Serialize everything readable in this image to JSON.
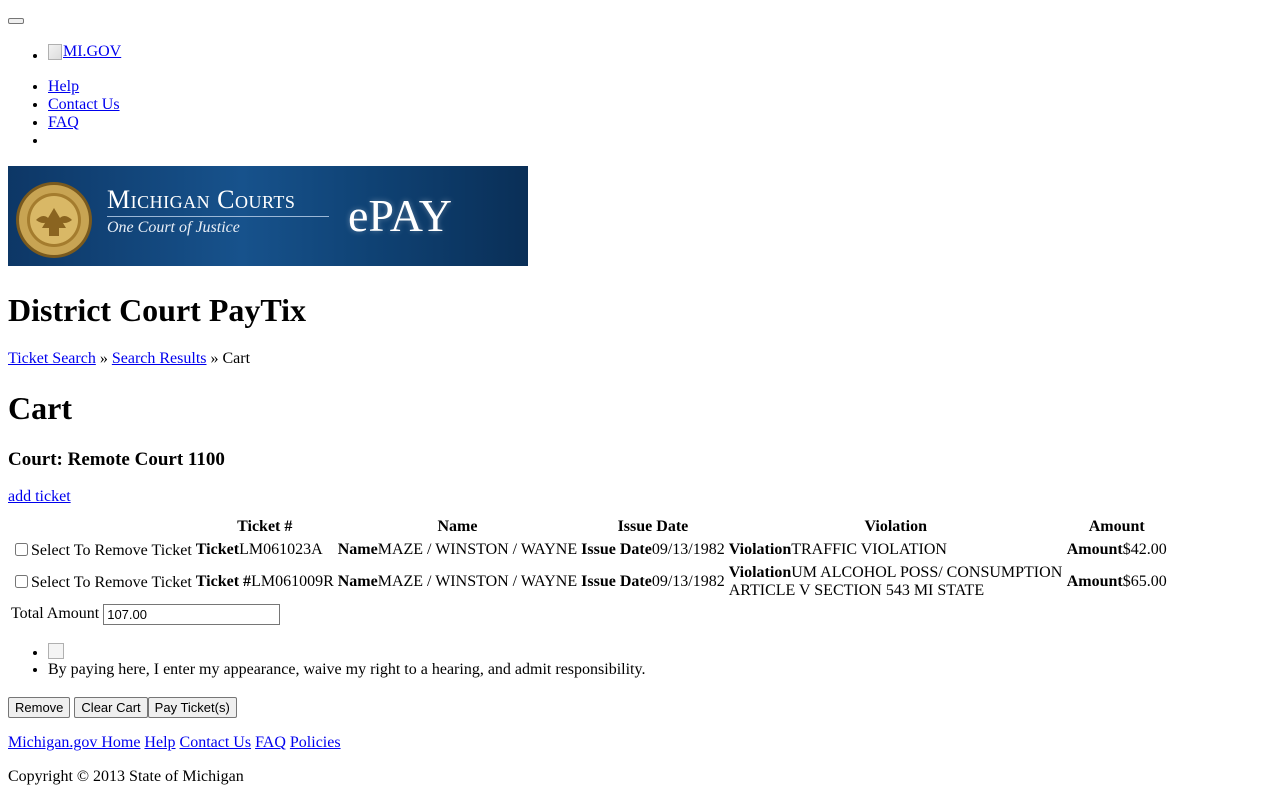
{
  "header": {
    "menu_button_label": "",
    "logo_alt": "MI.GOV",
    "nav_links": [
      "Help",
      "Contact Us",
      "FAQ"
    ]
  },
  "banner": {
    "title": "Michigan Courts",
    "subtitle": "One Court of Justice",
    "product": "ePAY",
    "colors": {
      "background": "#17528c",
      "text": "#ffffff"
    }
  },
  "page_title": "District Court PayTix",
  "breadcrumb": {
    "items": [
      "Ticket Search",
      "Search Results",
      "Cart"
    ],
    "separator": "»"
  },
  "cart": {
    "heading": "Cart",
    "court_heading": "Court: Remote Court 1100",
    "add_ticket_label": "add ticket",
    "columns": [
      "Ticket #",
      "Name",
      "Issue Date",
      "Violation",
      "Amount"
    ],
    "rows": [
      {
        "select_label": "Select To Remove Ticket",
        "ticket_label": "Ticket",
        "ticket": "LM061023A",
        "name_label": "Name",
        "name": "MAZE / WINSTON / WAYNE",
        "issue_date_label": "Issue Date",
        "issue_date": "09/13/1982",
        "violation_label": "Violation",
        "violation": "TRAFFIC VIOLATION",
        "amount_label": "Amount",
        "amount": "$42.00"
      },
      {
        "select_label": "Select To Remove Ticket",
        "ticket_label": "Ticket #",
        "ticket": "LM061009R",
        "name_label": "Name",
        "name": "MAZE / WINSTON / WAYNE",
        "issue_date_label": "Issue Date",
        "issue_date": "09/13/1982",
        "violation_label": "Violation",
        "violation": "UM ALCOHOL POSS/ CONSUMPTION ARTICLE V SECTION 543 MI STATE",
        "amount_label": "Amount",
        "amount": "$65.00"
      }
    ],
    "total_label": "Total Amount",
    "total_value": "107.00"
  },
  "terms": {
    "statement": "By paying here, I enter my appearance, waive my right to a hearing, and admit responsibility."
  },
  "buttons": {
    "remove": "Remove",
    "clear_cart": "Clear Cart",
    "pay": "Pay Ticket(s)"
  },
  "footer": {
    "links": [
      "Michigan.gov Home",
      "Help",
      "Contact Us",
      "FAQ",
      "Policies"
    ],
    "copyright": "Copyright © 2013 State of Michigan"
  }
}
